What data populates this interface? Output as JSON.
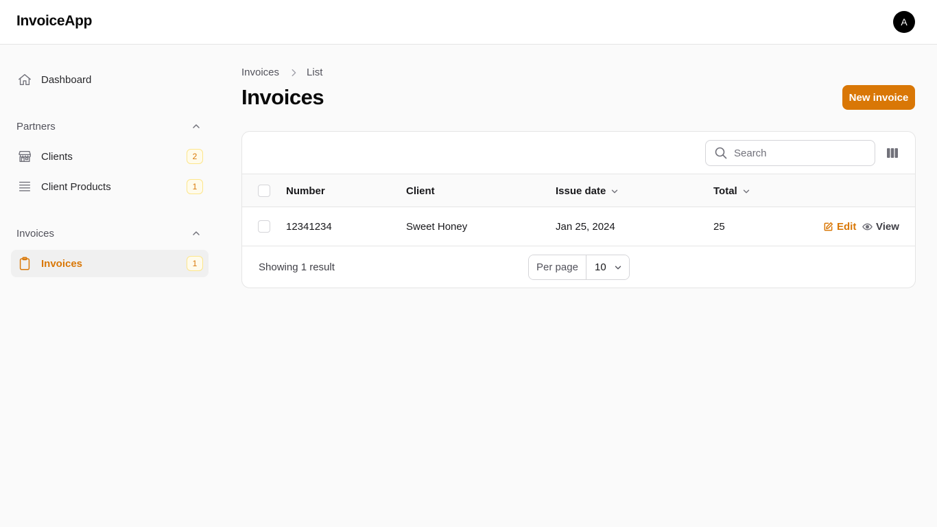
{
  "app": {
    "brand": "InvoiceApp",
    "avatar_initial": "A"
  },
  "sidebar": {
    "dashboard": {
      "label": "Dashboard",
      "icon": "home-icon"
    },
    "groups": [
      {
        "label": "Partners",
        "items": [
          {
            "label": "Clients",
            "badge": "2",
            "icon": "store-icon"
          },
          {
            "label": "Client Products",
            "badge": "1",
            "icon": "list-icon"
          }
        ]
      },
      {
        "label": "Invoices",
        "items": [
          {
            "label": "Invoices",
            "badge": "1",
            "icon": "clipboard-icon",
            "active": true
          }
        ]
      }
    ]
  },
  "breadcrumb": {
    "parent": "Invoices",
    "current": "List"
  },
  "page": {
    "title": "Invoices",
    "new_button": "New invoice"
  },
  "table": {
    "search_placeholder": "Search",
    "columns": [
      {
        "label": "Number",
        "sortable": false
      },
      {
        "label": "Client",
        "sortable": false
      },
      {
        "label": "Issue date",
        "sortable": true
      },
      {
        "label": "Total",
        "sortable": true
      }
    ],
    "rows": [
      {
        "number": "12341234",
        "client": "Sweet Honey",
        "issue_date": "Jan 25, 2024",
        "total": "25"
      }
    ],
    "actions": {
      "edit": "Edit",
      "view": "View"
    },
    "footer": {
      "showing": "Showing 1 result",
      "per_page_label": "Per page",
      "per_page_value": "10"
    }
  },
  "colors": {
    "accent": "#d97706",
    "badge_bg": "#fffbeb",
    "badge_border": "#fde68a"
  }
}
